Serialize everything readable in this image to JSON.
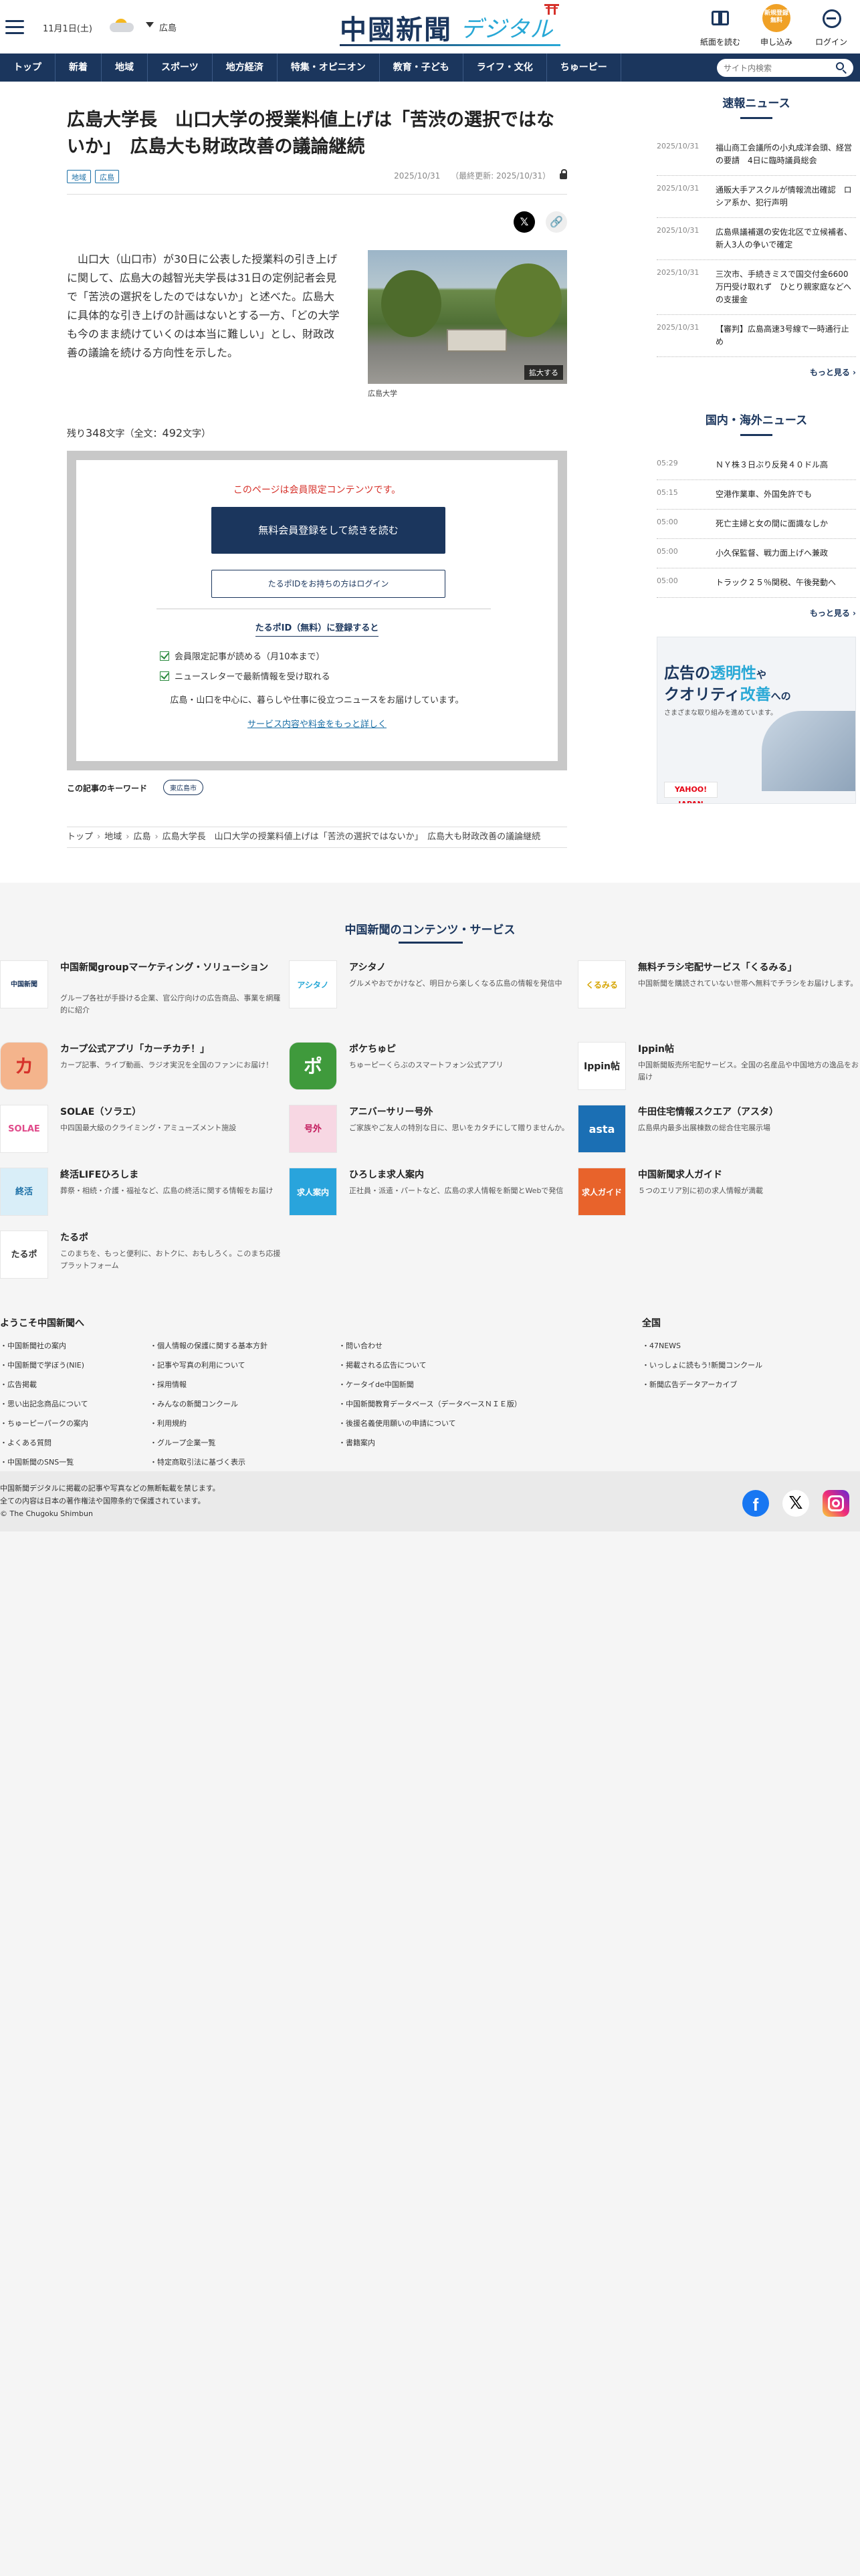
{
  "header": {
    "date": "11月1日(土)",
    "area": "広島",
    "logo_main": "中國新聞",
    "logo_sub": "デジタル",
    "btn_paper": "紙面を読む",
    "btn_apply_icon": "新規登録無料",
    "btn_apply": "申し込み",
    "btn_login": "ログイン"
  },
  "nav": {
    "items": [
      "トップ",
      "新着",
      "地域",
      "スポーツ",
      "地方経済",
      "特集・オピニオン",
      "教育・子ども",
      "ライフ・文化",
      "ちゅーピー"
    ],
    "search_placeholder": "サイト内検索"
  },
  "article": {
    "title": "広島大学長　山口大学の授業料値上げは「苦渋の選択ではないか」　広島大も財政改善の議論継続",
    "tags": [
      "地域",
      "広島"
    ],
    "date": "2025/10/31",
    "updated": "（最終更新: 2025/10/31）",
    "lead": "　山口大（山口市）が30日に公表した授業料の引き上げに関して、広島大の越智光夫学長は31日の定例記者会見で「苦渋の選択をしたのではないか」と述べた。広島大に具体的な引き上げの計画はないとする一方、「どの大学も今のまま続けていくのは本当に難しい」とし、財政改善の議論を続ける方向性を示した。",
    "photo_zoom": "拡大する",
    "caption": "広島大学",
    "remain_prefix": "残り",
    "remain_chars": "348",
    "remain_mid": "文字（全文：",
    "total_chars": "492",
    "remain_suffix": "文字）"
  },
  "paywall": {
    "note": "このページは会員限定コンテンツです。",
    "register": "無料会員登録をして続きを読む",
    "login": "たるポIDをお持ちの方はログイン",
    "heading": "たるポID（無料）に登録すると",
    "benefits": [
      "会員限定記事が読める（月10本まで）",
      "ニュースレターで最新情報を受け取れる"
    ],
    "desc": "広島・山口を中心に、暮らしや仕事に役立つニュースをお届けしています。",
    "more": "サービス内容や料金をもっと詳しく"
  },
  "keywords": {
    "label": "この記事のキーワード",
    "tag": "東広島市"
  },
  "breadcrumb": [
    "トップ",
    "地域",
    "広島",
    "広島大学長　山口大学の授業料値上げは「苦渋の選択ではないか」　広島大も財政改善の議論継続"
  ],
  "breaking": {
    "title": "速報ニュース",
    "items": [
      {
        "date": "2025/10/31",
        "text": "福山商工会議所の小丸成洋会頭、経営の要請　4日に臨時議員総会"
      },
      {
        "date": "2025/10/31",
        "text": "通販大手アスクルが情報流出確認　ロシア系か、犯行声明"
      },
      {
        "date": "2025/10/31",
        "text": "広島県議補選の安佐北区で立候補者、新人3人の争いで確定"
      },
      {
        "date": "2025/10/31",
        "text": "三次市、手続きミスで国交付金6600万円受け取れず　ひとり親家庭などへの支援金"
      },
      {
        "date": "2025/10/31",
        "text": "【審判】広島高速3号線で一時通行止め"
      }
    ],
    "more": "もっと見る"
  },
  "world": {
    "title": "国内・海外ニュース",
    "items": [
      {
        "date": "05:29",
        "text": "ＮＹ株３日ぶり反発４０ドル高"
      },
      {
        "date": "05:15",
        "text": "空港作業車、外国免許でも"
      },
      {
        "date": "05:00",
        "text": "死亡主婦と女の間に面識なしか"
      },
      {
        "date": "05:00",
        "text": "小久保監督、戦力面上げへ兼政"
      },
      {
        "date": "05:00",
        "text": "トラック２５％関税、午後発動へ"
      }
    ],
    "more": "もっと見る"
  },
  "ad": {
    "line1a": "広告の",
    "line1b": "透明性",
    "line1c": "や",
    "line2a": "クオリティ",
    "line2b": "改善",
    "line2c": "への",
    "line3": "さまざまな取り組みを進めています。",
    "logo": "YAHOO! JAPAN"
  },
  "services": {
    "title": "中国新聞のコンテンツ・サービス",
    "items": [
      {
        "name": "中国新聞groupマーケティング・ソリューション",
        "desc": "グループ各社が手掛ける企業、官公庁向けの広告商品、事業を網羅的に紹介",
        "icon": "中国新聞group"
      },
      {
        "name": "アシタノ",
        "desc": "グルメやおでかけなど、明日から楽しくなる広島の情報を発信中",
        "icon": "アシタノ"
      },
      {
        "name": "無料チラシ宅配サービス「くるみる」",
        "desc": "中国新聞を購読されていない世帯へ無料でチラシをお届けします。",
        "icon": "くるみる"
      },
      {
        "name": "カープ公式アプリ「カーチカチ！」",
        "desc": "カープ記事、ライブ動画、ラジオ実況を全国のファンにお届け！",
        "icon": "カ"
      },
      {
        "name": "ポケちゅピ",
        "desc": "ちゅーピーくらぶのスマートフォン公式アプリ",
        "icon": "ポ"
      },
      {
        "name": "Ippin帖",
        "desc": "中国新聞販売所宅配サービス。全国の名産品や中国地方の逸品をお届け",
        "icon": "Ippin帖"
      },
      {
        "name": "SOLAE（ソラエ）",
        "desc": "中四国最大級のクライミング・アミューズメント施設",
        "icon": "SOLAE"
      },
      {
        "name": "アニバーサリー号外",
        "desc": "ご家族やご友人の特別な日に、思いをカタチにして贈りませんか。",
        "icon": "号外"
      },
      {
        "name": "牛田住宅情報スクエア（アスタ）",
        "desc": "広島県内最多出展棟数の総合住宅展示場",
        "icon": "asta"
      },
      {
        "name": "終活LIFEひろしま",
        "desc": "葬祭・相続・介護・福祉など、広島の終活に関する情報をお届け",
        "icon": "終活"
      },
      {
        "name": "ひろしま求人案内",
        "desc": "正社員・派遣・パートなど、広島の求人情報を新聞とWebで発信",
        "icon": "求人案内"
      },
      {
        "name": "中国新聞求人ガイド",
        "desc": "５つのエリア別に初の求人情報が満載",
        "icon": "求人ガイド"
      },
      {
        "name": "たるポ",
        "desc": "このまちを、もっと便利に、おトクに、おもしろく。このまち応援プラットフォーム",
        "icon": "たるポ"
      }
    ]
  },
  "links": {
    "welcome_title": "ようこそ中国新聞へ",
    "col1": [
      "中国新聞社の案内",
      "中国新聞で学ぼう(NIE)",
      "広告掲載",
      "思い出記念商品について",
      "ちゅーピーパークの案内",
      "よくある質問",
      "中国新聞のSNS一覧"
    ],
    "col2": [
      "個人情報の保護に関する基本方針",
      "記事や写真の利用について",
      "採用情報",
      "みんなの新聞コンクール",
      "利用規約",
      "グループ企業一覧",
      "特定商取引法に基づく表示"
    ],
    "col3": [
      "問い合わせ",
      "掲載される広告について",
      "ケータイde中国新聞",
      "中国新聞教育データベース（データベースＮＩＥ版）",
      "後援名義使用願いの申請について",
      "書籍案内"
    ],
    "national_title": "全国",
    "national": [
      "47NEWS",
      "いっしょに読もう!新聞コンクール",
      "新聞広告データアーカイブ"
    ]
  },
  "copyright": {
    "line1": "中国新聞デジタルに掲載の記事や写真などの無断転載を禁じます。",
    "line2": "全ての内容は日本の著作権法や国際条約で保護されています。",
    "line3": "© The Chugoku Shimbun"
  }
}
